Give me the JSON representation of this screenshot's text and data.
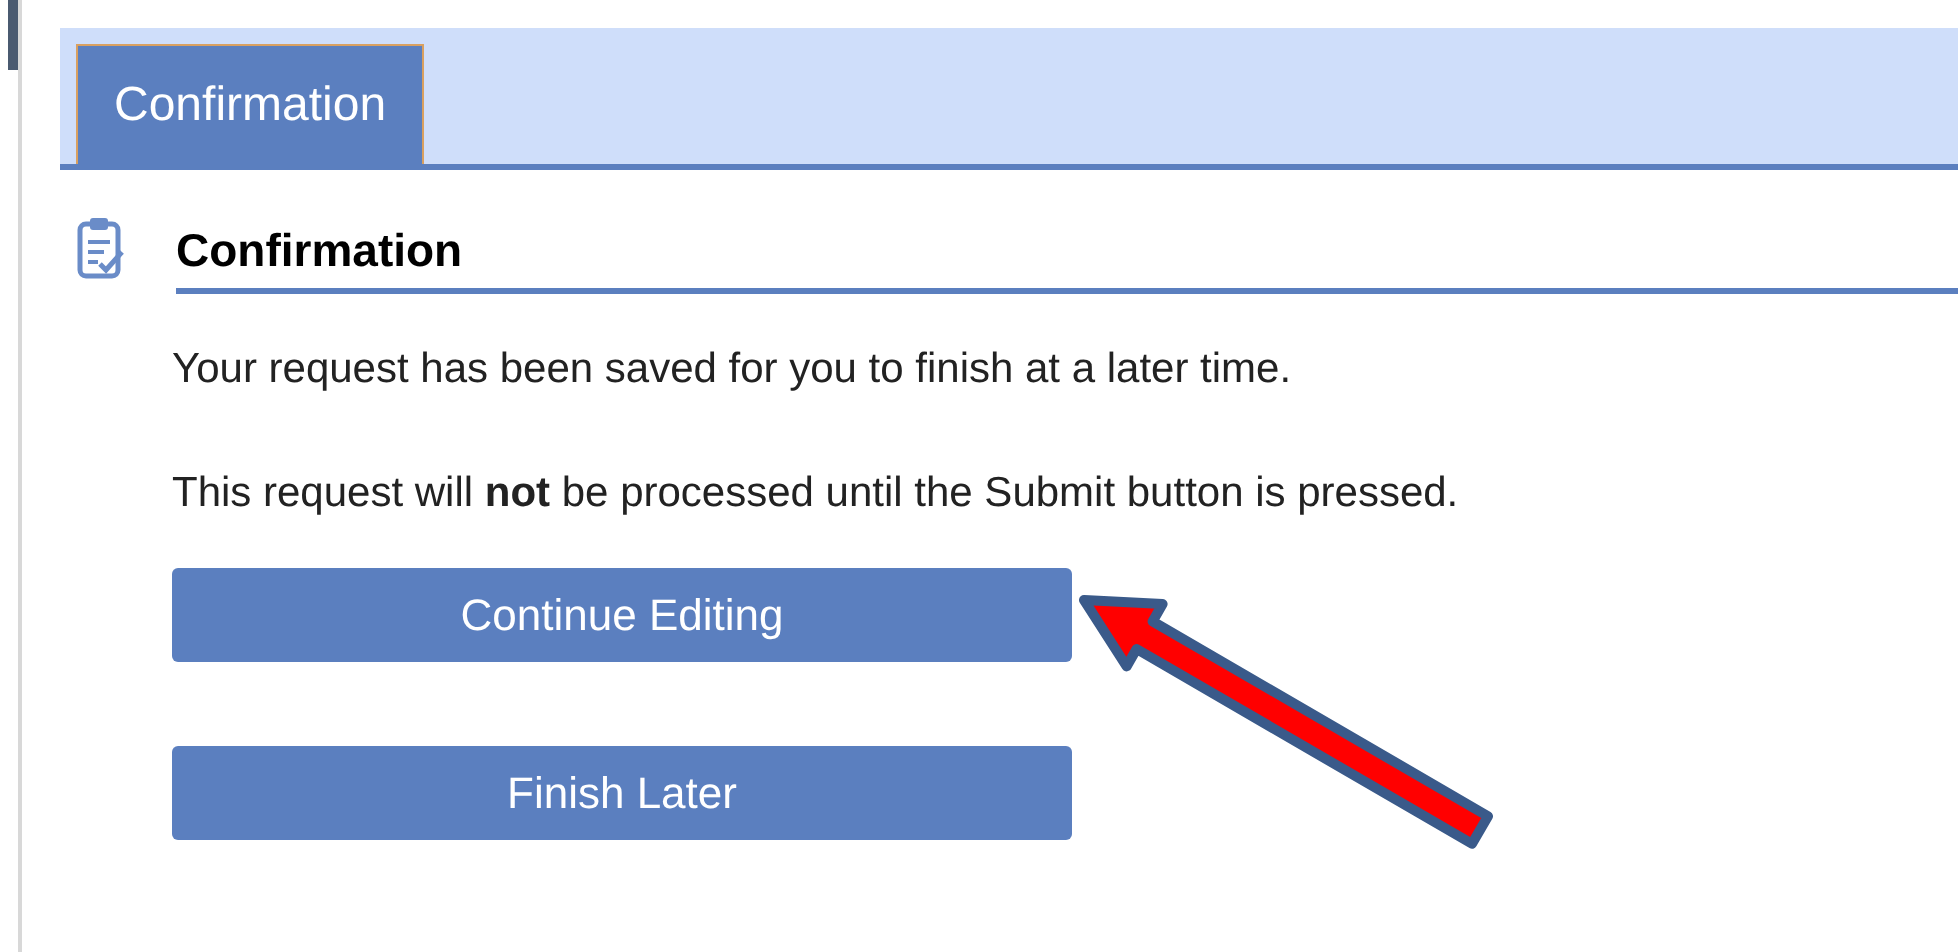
{
  "tabs": [
    {
      "label": "Confirmation",
      "selected": true
    }
  ],
  "section": {
    "title": "Confirmation"
  },
  "messages": [
    "Your request has been saved for you to finish at a later time.",
    "This request will **not** be processed until the Submit button is pressed."
  ],
  "buttons": [
    {
      "label": "Continue Editing"
    },
    {
      "label": "Finish Later"
    }
  ]
}
